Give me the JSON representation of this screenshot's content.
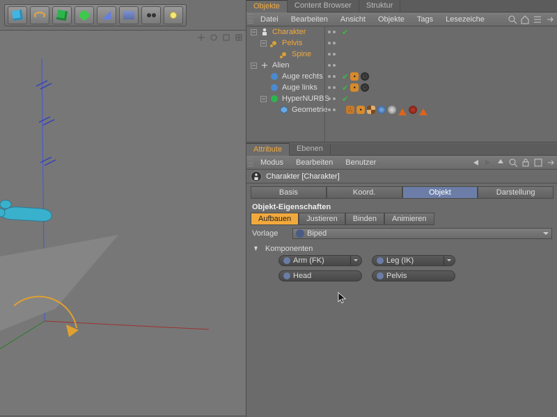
{
  "toolbar_icons": [
    "cube",
    "snake",
    "cube2",
    "gear",
    "wedge",
    "grid",
    "eyes",
    "bulb"
  ],
  "objects_panel": {
    "tabs": [
      "Objekte",
      "Content Browser",
      "Struktur"
    ],
    "menus": [
      "Datei",
      "Bearbeiten",
      "Ansicht",
      "Objekte",
      "Tags",
      "Lesezeiche"
    ],
    "tree": [
      {
        "name": "Charakter",
        "depth": 0,
        "sel": true,
        "icon": "char",
        "exp": "-"
      },
      {
        "name": "Pelvis",
        "depth": 1,
        "sel": true,
        "icon": "joint",
        "exp": "-"
      },
      {
        "name": "Spine",
        "depth": 2,
        "sel": true,
        "icon": "joint",
        "exp": ""
      },
      {
        "name": "Alien",
        "depth": 0,
        "sel": false,
        "icon": "null",
        "exp": "-"
      },
      {
        "name": "Auge rechts",
        "depth": 1,
        "sel": false,
        "icon": "sphere",
        "exp": ""
      },
      {
        "name": "Auge links",
        "depth": 1,
        "sel": false,
        "icon": "sphere",
        "exp": ""
      },
      {
        "name": "HyperNURBS",
        "depth": 1,
        "sel": false,
        "icon": "hn",
        "exp": "-"
      },
      {
        "name": "Geometrie",
        "depth": 2,
        "sel": false,
        "icon": "poly",
        "exp": ""
      }
    ]
  },
  "attribute_panel": {
    "tabs": [
      "Attribute",
      "Ebenen"
    ],
    "menus": [
      "Modus",
      "Bearbeiten",
      "Benutzer"
    ],
    "obj_label": "Charakter [Charakter]",
    "main_tabs": [
      "Basis",
      "Koord.",
      "Objekt",
      "Darstellung"
    ],
    "active_main": 2,
    "section": "Objekt-Eigenschaften",
    "sub_tabs": [
      "Aufbauen",
      "Justieren",
      "Binden",
      "Animieren"
    ],
    "active_sub": 0,
    "vorlage_label": "Vorlage",
    "vorlage_value": "Biped",
    "komponenten_label": "Komponenten",
    "komponenten": [
      {
        "label": "Arm (FK)",
        "hasDrop": true
      },
      {
        "label": "Leg (IK)",
        "hasDrop": true
      },
      {
        "label": "Head",
        "hasDrop": false
      },
      {
        "label": "Pelvis",
        "hasDrop": false
      }
    ]
  }
}
